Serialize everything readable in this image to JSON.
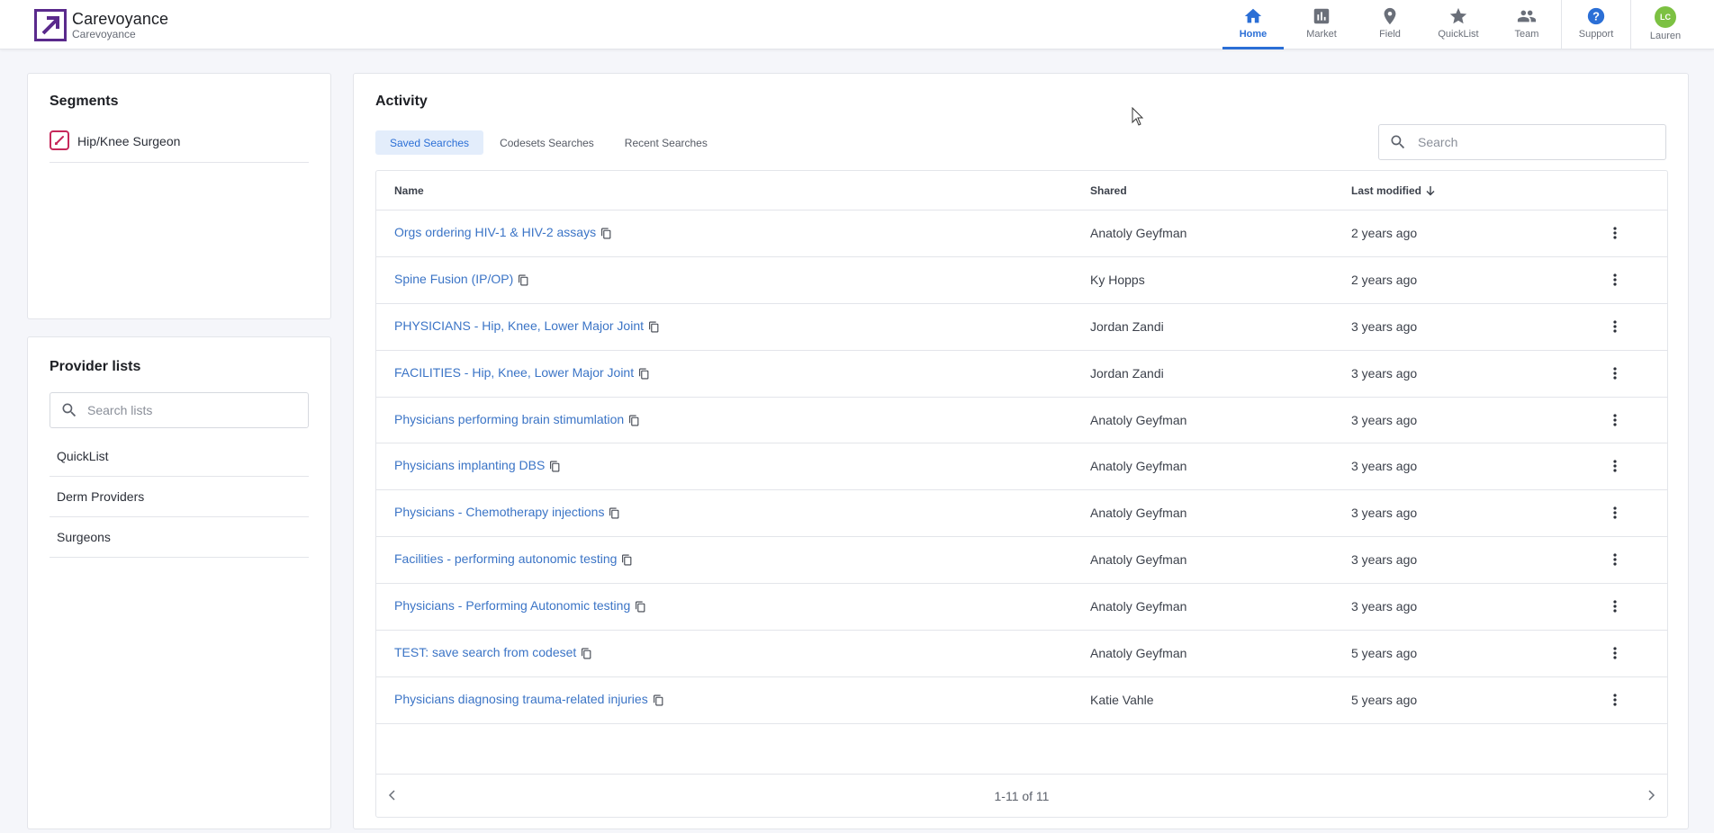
{
  "brand": {
    "name": "Carevoyance",
    "subtitle": "Carevoyance"
  },
  "nav": {
    "items": [
      {
        "label": "Home",
        "icon": "home-icon",
        "active": true
      },
      {
        "label": "Market",
        "icon": "bar-chart-icon"
      },
      {
        "label": "Field",
        "icon": "map-pin-icon"
      },
      {
        "label": "QuickList",
        "icon": "star-icon"
      },
      {
        "label": "Team",
        "icon": "people-icon"
      }
    ],
    "support": {
      "label": "Support",
      "icon": "help-icon"
    },
    "user": {
      "label": "Lauren",
      "initials": "LC",
      "avatar_color": "#7cc142"
    }
  },
  "segments": {
    "title": "Segments",
    "items": [
      {
        "label": "Hip/Knee Surgeon",
        "icon": "scalpel-icon",
        "color": "#c6285a"
      }
    ]
  },
  "providers": {
    "title": "Provider lists",
    "search_placeholder": "Search lists",
    "items": [
      {
        "label": "QuickList"
      },
      {
        "label": "Derm Providers"
      },
      {
        "label": "Surgeons"
      }
    ]
  },
  "activity": {
    "title": "Activity",
    "tabs": [
      {
        "label": "Saved Searches",
        "active": true
      },
      {
        "label": "Codesets Searches"
      },
      {
        "label": "Recent Searches"
      }
    ],
    "search_placeholder": "Search",
    "columns": {
      "name": "Name",
      "shared": "Shared",
      "modified": "Last modified"
    },
    "rows": [
      {
        "name": "Orgs ordering HIV-1 & HIV-2 assays",
        "shared": "Anatoly Geyfman",
        "modified": "2 years ago"
      },
      {
        "name": "Spine Fusion (IP/OP)",
        "shared": "Ky Hopps",
        "modified": "2 years ago"
      },
      {
        "name": "PHYSICIANS - Hip, Knee, Lower Major Joint",
        "shared": "Jordan Zandi",
        "modified": "3 years ago"
      },
      {
        "name": "FACILITIES - Hip, Knee, Lower Major Joint",
        "shared": "Jordan Zandi",
        "modified": "3 years ago"
      },
      {
        "name": "Physicians performing brain stimumlation",
        "shared": "Anatoly Geyfman",
        "modified": "3 years ago"
      },
      {
        "name": "Physicians implanting DBS",
        "shared": "Anatoly Geyfman",
        "modified": "3 years ago"
      },
      {
        "name": "Physicians - Chemotherapy injections",
        "shared": "Anatoly Geyfman",
        "modified": "3 years ago"
      },
      {
        "name": "Facilities - performing autonomic testing",
        "shared": "Anatoly Geyfman",
        "modified": "3 years ago"
      },
      {
        "name": "Physicians - Performing Autonomic testing",
        "shared": "Anatoly Geyfman",
        "modified": "3 years ago"
      },
      {
        "name": "TEST: save search from codeset",
        "shared": "Anatoly Geyfman",
        "modified": "5 years ago"
      },
      {
        "name": "Physicians diagnosing trauma-related injuries",
        "shared": "Katie Vahle",
        "modified": "5 years ago"
      }
    ],
    "pagination": "1-11 of 11"
  },
  "colors": {
    "accent": "#2b6fd6",
    "link": "#3b74c6",
    "brand": "#5a2a8c"
  }
}
